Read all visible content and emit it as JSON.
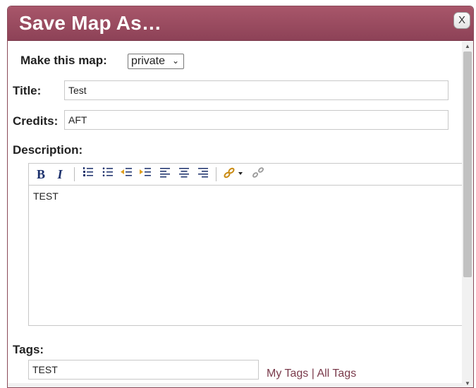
{
  "dialog": {
    "title": "Save Map As…",
    "close_label": "X"
  },
  "form": {
    "make_label": "Make this map:",
    "visibility_value": "private",
    "title_label": "Title:",
    "title_value": "Test",
    "credits_label": "Credits:",
    "credits_value": "AFT",
    "description_label": "Description:",
    "description_value": "TEST",
    "tags_label": "Tags:",
    "tags_value": "TEST",
    "my_tags_link": "My Tags",
    "tags_separator": " | ",
    "all_tags_link": "All Tags"
  },
  "toolbar": {
    "bold": "B",
    "italic": "I",
    "icons": [
      "ordered-list-icon",
      "unordered-list-icon",
      "outdent-icon",
      "indent-icon",
      "align-left-icon",
      "align-center-icon",
      "align-right-icon",
      "link-icon",
      "unlink-icon"
    ]
  },
  "colors": {
    "titlebar": "#8d4257",
    "link": "#7a3a4b"
  }
}
